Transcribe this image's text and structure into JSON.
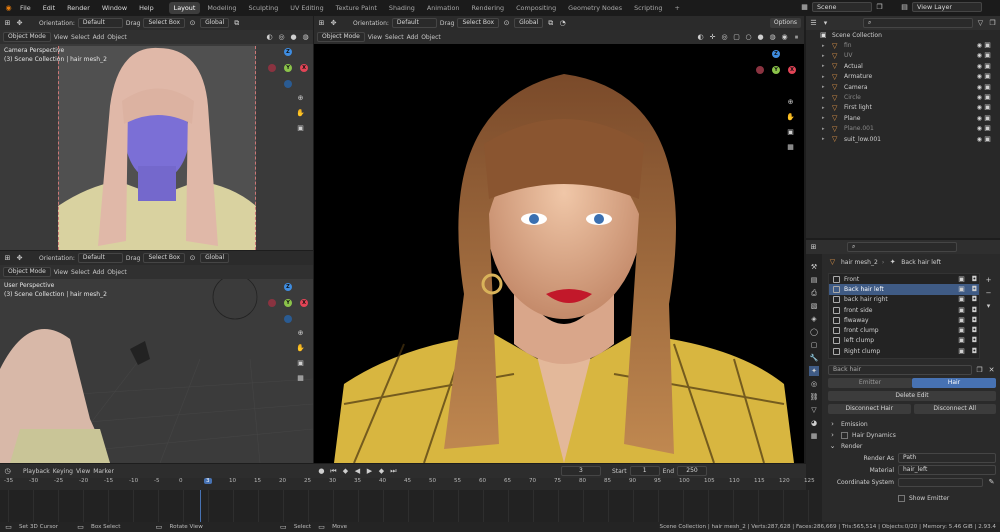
{
  "topbar": {
    "menus": [
      "File",
      "Edit",
      "Render",
      "Window",
      "Help"
    ],
    "workspaces": [
      "Layout",
      "Modeling",
      "Sculpting",
      "UV Editing",
      "Texture Paint",
      "Shading",
      "Animation",
      "Rendering",
      "Compositing",
      "Geometry Nodes",
      "Scripting"
    ],
    "active_workspace": "Layout",
    "add_tab": "+",
    "scene": "Scene",
    "view_layer": "View Layer"
  },
  "viewport_header": {
    "orientation_label": "Orientation:",
    "orientation_value": "Default",
    "drag_label": "Drag",
    "select_box": "Select Box",
    "transform": "Global",
    "options": "Options"
  },
  "viewport_menu": {
    "mode": "Object Mode",
    "items": [
      "View",
      "Select",
      "Add",
      "Object"
    ]
  },
  "viewport_tl": {
    "perspective": "Camera Perspective",
    "collection": "(3) Scene Collection | hair mesh_2"
  },
  "viewport_bl": {
    "perspective": "User Perspective",
    "collection": "(3) Scene Collection | hair mesh_2"
  },
  "gizmo": {
    "x": "X",
    "y": "Y",
    "z": "Z"
  },
  "outliner": {
    "root": "Scene Collection",
    "items": [
      {
        "name": "fin",
        "dim": true
      },
      {
        "name": "UV",
        "dim": true
      },
      {
        "name": "Actual",
        "dim": false
      },
      {
        "name": "Armature",
        "dim": false
      },
      {
        "name": "Camera",
        "dim": false
      },
      {
        "name": "Circle",
        "dim": true
      },
      {
        "name": "First light",
        "dim": false
      },
      {
        "name": "Plane",
        "dim": false
      },
      {
        "name": "Plane.001",
        "dim": true
      },
      {
        "name": "suit_low.001",
        "dim": false
      }
    ]
  },
  "properties": {
    "object": "hair mesh_2",
    "hair": "Back hair left",
    "hair_list": [
      "Front",
      "Back hair left",
      "back hair right",
      "front side",
      "flwaway",
      "front clump",
      "left clump",
      "Right clump"
    ],
    "selected_hair": "Back hair left",
    "hair_name_field": "Back hair",
    "mode_tabs": [
      "Emitter",
      "Hair"
    ],
    "active_mode": "Hair",
    "delete_edit": "Delete Edit",
    "disconnect_hair": "Disconnect Hair",
    "disconnect_all": "Disconnect All",
    "emission": "Emission",
    "hair_dynamics": "Hair Dynamics",
    "render_section": "Render",
    "render_as_label": "Render As",
    "render_as_value": "Path",
    "material_label": "Material",
    "material_value": "hair_left",
    "coord_label": "Coordinate System",
    "show_emitter": "Show Emitter"
  },
  "timeline": {
    "menus": [
      "Playback",
      "Keying",
      "View",
      "Marker"
    ],
    "current_frame": "3",
    "start_label": "Start",
    "start_value": "1",
    "end_label": "End",
    "end_value": "250",
    "ticks": [
      "-35",
      "-30",
      "-25",
      "-20",
      "-15",
      "-10",
      "-5",
      "0",
      "3",
      "10",
      "15",
      "20",
      "25",
      "30",
      "35",
      "40",
      "45",
      "50",
      "55",
      "60",
      "65",
      "70",
      "75",
      "80",
      "85",
      "90",
      "95",
      "100",
      "105",
      "110",
      "115",
      "120",
      "125"
    ]
  },
  "statusbar": {
    "left": [
      "Set 3D Cursor",
      "Box Select",
      "Rotate View",
      "Select",
      "Move"
    ],
    "right": "Scene Collection | hair mesh_2 | Verts:287,628 | Faces:286,669 | Tris:565,514 | Objects:0/20 | Memory: 5.46 GiB | 2.93.4"
  },
  "colors": {
    "accent_blue": "#4772b3",
    "selection": "#3f5b85",
    "axis_x": "#e24456",
    "axis_y": "#8bc34a",
    "axis_z": "#3e8ce0",
    "playhead": "#4772b3"
  }
}
